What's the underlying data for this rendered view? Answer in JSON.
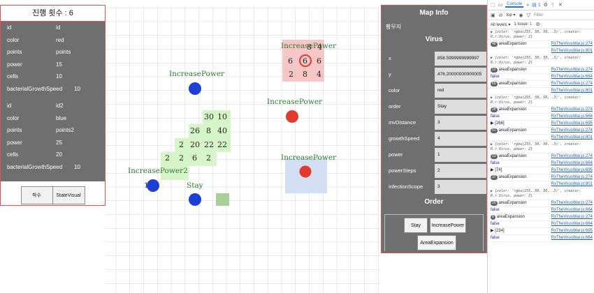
{
  "left_panel": {
    "round_label": "진행 횟수 : 6",
    "objects": [
      {
        "rows": [
          {
            "key": "id",
            "value": "id"
          },
          {
            "key": "color",
            "value": "red"
          },
          {
            "key": "points",
            "value": "points"
          },
          {
            "key": "power",
            "value": "15"
          },
          {
            "key": "cells",
            "value": "10"
          },
          {
            "key": "bacterialGrowthSpeed",
            "value": "10"
          }
        ]
      },
      {
        "rows": [
          {
            "key": "id",
            "value": "id2"
          },
          {
            "key": "color",
            "value": "blue"
          },
          {
            "key": "points",
            "value": "points2"
          },
          {
            "key": "power",
            "value": "25"
          },
          {
            "key": "cells",
            "value": "20"
          },
          {
            "key": "bacterialGrowthSpeed",
            "value": "10"
          }
        ]
      }
    ],
    "buttons": {
      "place": "착수",
      "state_visual": "StateVisual"
    }
  },
  "map": {
    "labels": {
      "increase_power_a": "IncreasePower",
      "increase_power_b": "IncreasePower",
      "increase_power_c": "IncreasePower",
      "increase_power_d": "IncreasePower",
      "increase_power_e": "IncreasePower2",
      "stay": "Stay",
      "blue_partial": "1  3"
    },
    "red_block_numbers": [
      "8",
      "4",
      "6",
      "6",
      "6",
      "2",
      "8",
      "4"
    ],
    "green_block_numbers": [
      "30",
      "10",
      "26",
      "8",
      "40",
      "2",
      "20",
      "22",
      "22",
      "2",
      "2",
      "6",
      "2"
    ],
    "colors": {
      "red_virus": "#e23b2e",
      "blue_virus": "#1c3fd6",
      "green_tile": "#d6f5c8",
      "red_tile": "#f7c6c6",
      "blue_tile": "#d4def5"
    }
  },
  "info_panel": {
    "title": "Map Info",
    "tile_name": "황무지",
    "virus_section": "Virus",
    "fields": [
      {
        "key": "x",
        "value": "858.5999999999997"
      },
      {
        "key": "y",
        "value": "476.20000000000005"
      },
      {
        "key": "color",
        "value": "red"
      },
      {
        "key": "order",
        "value": "Stay"
      },
      {
        "key": "mvDistance",
        "value": "3"
      },
      {
        "key": "growthSpeed",
        "value": "4"
      },
      {
        "key": "power",
        "value": "1"
      },
      {
        "key": "powerSteps",
        "value": "2"
      },
      {
        "key": "infectionScope",
        "value": "3"
      }
    ],
    "order_section": "Order",
    "order_buttons": {
      "stay": "Stay",
      "increase_power": "IncreasePower",
      "area_expansion": "AreaExpansion"
    }
  },
  "devtools": {
    "tab_console": "Console",
    "more_tabs": "»",
    "badge": "1",
    "filter_placeholder": "Filter",
    "context": "top ▾",
    "levels": "All levels ▾",
    "issues": "1 Issue: ",
    "issues_count": "1",
    "logs": [
      {
        "kind": "obj",
        "msg": "▶ {color: 'rgba(255, 50, 50, .3)', creator: R.r.Virus, power: 2}",
        "src": ""
      },
      {
        "kind": "msg",
        "count": "48",
        "msg": "areaExpansion",
        "src": "RxTheVirusWar.js:274"
      },
      {
        "kind": "msg",
        "msg": "",
        "src": "RxTheVirusWar.js:801"
      },
      {
        "kind": "obj",
        "msg": "▶ {color: 'rgba(255, 50, 50, .3)', creator: R.r.Virus, power: 2}",
        "src": ""
      },
      {
        "kind": "msg",
        "count": "12",
        "msg": "areaExpansion",
        "src": "RxTheVirusWar.js:274"
      },
      {
        "kind": "msg",
        "msg": "false",
        "src": "RxTheVirusWar.js:664"
      },
      {
        "kind": "msg",
        "count": "69",
        "msg": "areaExpansion",
        "src": "RxTheVirusWar.js:274"
      },
      {
        "kind": "msg",
        "msg": "",
        "src": "RxTheVirusWar.js:801"
      },
      {
        "kind": "obj",
        "msg": "▶ {color: 'rgba(255, 50, 50, .3)', creator: R.r.Virus, power: 2}",
        "src": ""
      },
      {
        "kind": "msg",
        "count": "28",
        "msg": "areaExpansion",
        "src": "RxTheVirusWar.js:274"
      },
      {
        "kind": "msg",
        "msg": "false",
        "src": "RxTheVirusWar.js:664"
      },
      {
        "kind": "msg",
        "msg": "▶ [266]",
        "src": "RxTheVirusWar.js:695"
      },
      {
        "kind": "msg",
        "count": "51",
        "msg": "areaExpansion",
        "src": "RxTheVirusWar.js:274"
      },
      {
        "kind": "msg",
        "msg": "",
        "src": "RxTheVirusWar.js:801"
      },
      {
        "kind": "obj",
        "msg": "▶ {color: 'rgba(255, 50, 50, .3)', creator: R.r.Virus, power: 2}",
        "src": ""
      },
      {
        "kind": "msg",
        "count": "23",
        "msg": "areaExpansion",
        "src": "RxTheVirusWar.js:274"
      },
      {
        "kind": "msg",
        "msg": "false",
        "src": "RxTheVirusWar.js:664"
      },
      {
        "kind": "msg",
        "msg": "▶ [74]",
        "src": "RxTheVirusWar.js:695"
      },
      {
        "kind": "msg",
        "count": "37",
        "msg": "areaExpansion",
        "src": "RxTheVirusWar.js:274"
      },
      {
        "kind": "msg",
        "msg": "",
        "src": "RxTheVirusWar.js:801"
      },
      {
        "kind": "obj",
        "msg": "▶ {color: 'rgba(255, 50, 50, .3)', creator: R.r.Virus, power: 2}",
        "src": ""
      },
      {
        "kind": "msg",
        "count": "20",
        "msg": "areaExpansion",
        "src": "RxTheVirusWar.js:274"
      },
      {
        "kind": "msg",
        "msg": "false",
        "src": "RxTheVirusWar.js:664"
      },
      {
        "kind": "msg",
        "count": "8",
        "msg": "areaExpansion",
        "src": "RxTheVirusWar.js:274"
      },
      {
        "kind": "msg",
        "msg": "false",
        "src": "RxTheVirusWar.js:664"
      },
      {
        "kind": "msg",
        "msg": "▶ [234]",
        "src": "RxTheVirusWar.js:695"
      },
      {
        "kind": "msg",
        "msg": "false",
        "src": "RxTheVirusWar.js:664"
      }
    ]
  }
}
